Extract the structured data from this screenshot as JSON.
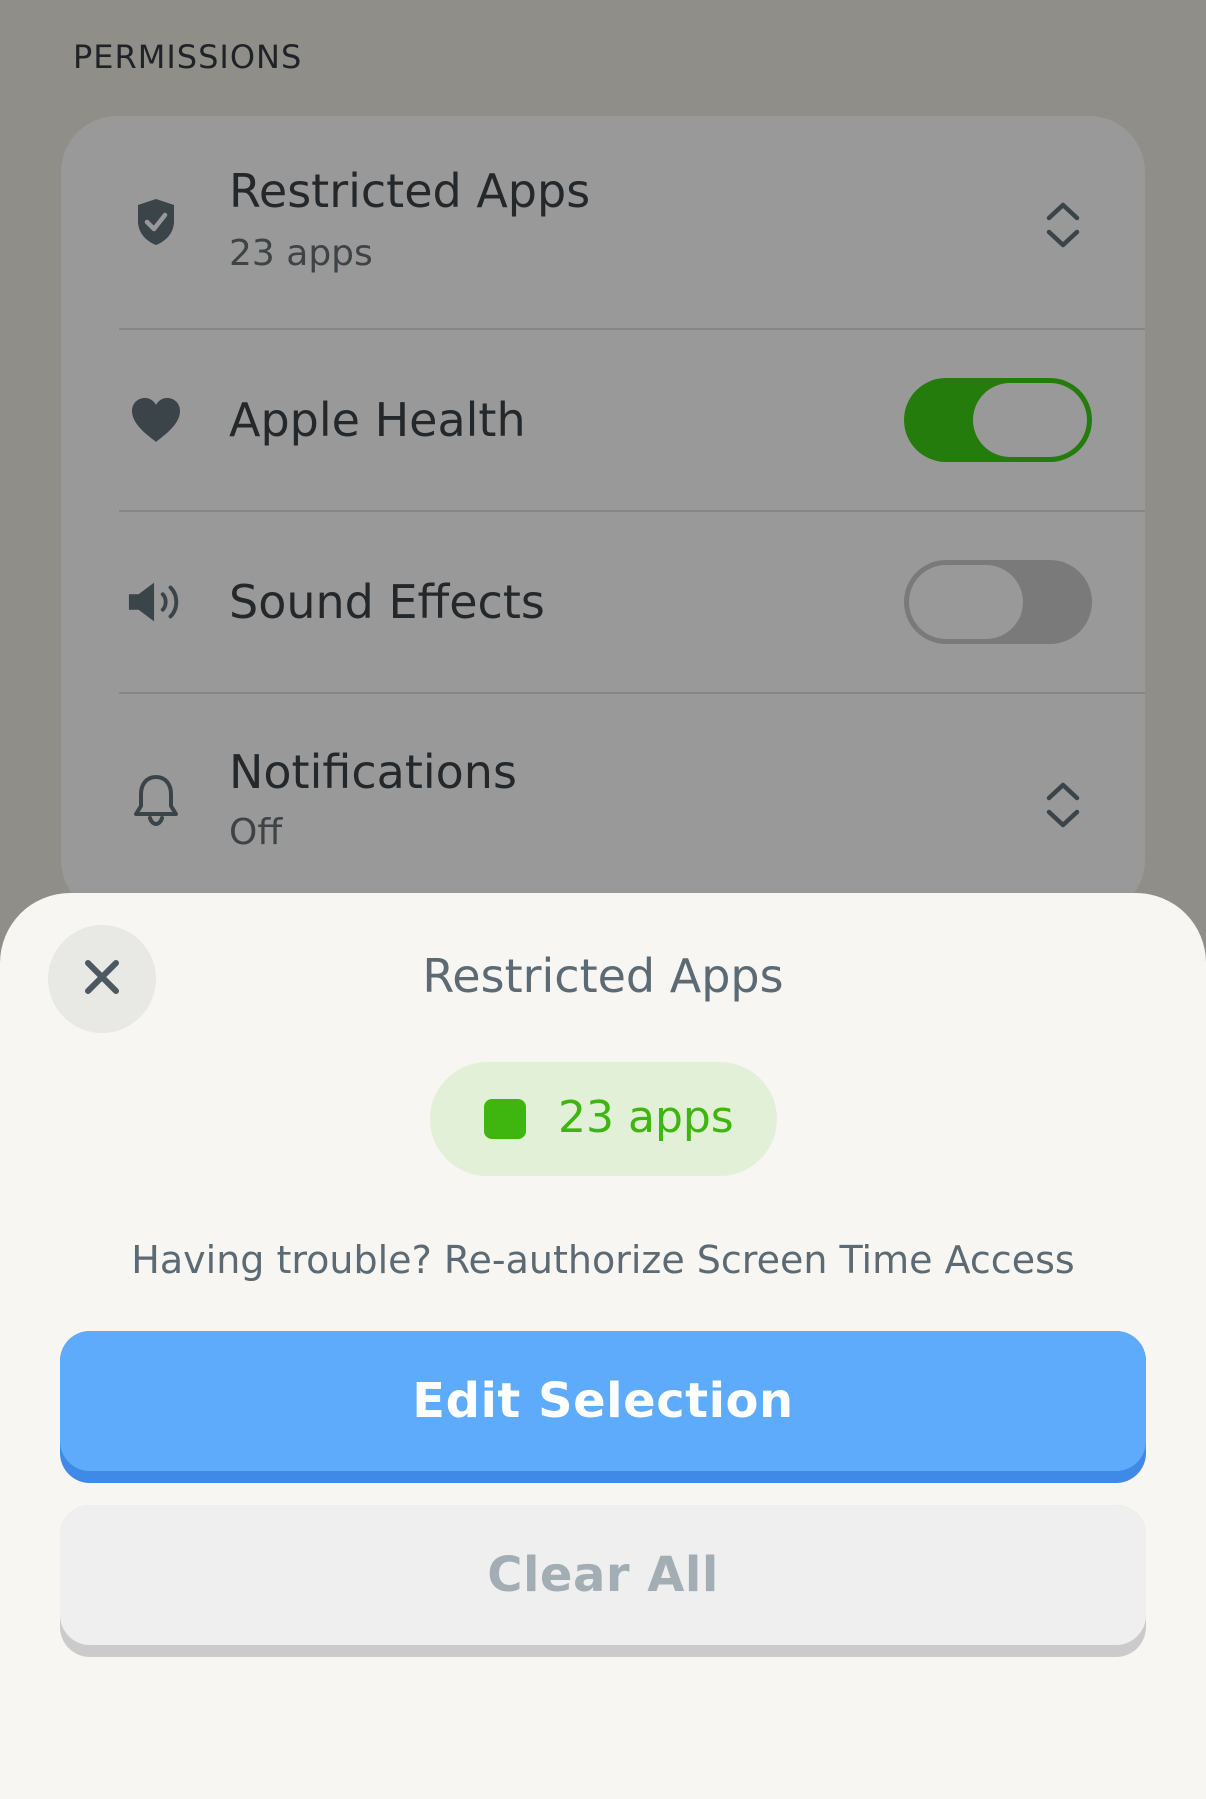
{
  "permissions": {
    "section_title": "PERMISSIONS",
    "rows": [
      {
        "icon": "shield-check-icon",
        "title": "Restricted Apps",
        "subtitle": "23 apps",
        "control": "chevron-up-down-icon"
      },
      {
        "icon": "heart-icon",
        "title": "Apple Health",
        "control": "toggle",
        "toggle_on": true
      },
      {
        "icon": "speaker-icon",
        "title": "Sound Effects",
        "control": "toggle",
        "toggle_on": false
      },
      {
        "icon": "bell-icon",
        "title": "Notifications",
        "subtitle": "Off",
        "control": "chevron-up-down-icon"
      }
    ]
  },
  "sheet": {
    "close_icon": "close-icon",
    "title": "Restricted Apps",
    "app_count_label": "23 apps",
    "trouble_text": "Having trouble? Re-authorize Screen Time Access",
    "edit_button_label": "Edit Selection",
    "clear_button_label": "Clear All"
  },
  "colors": {
    "toggle_on": "#247c0d",
    "accent_green": "#3fb60f",
    "primary_button": "#5eaafb",
    "sheet_background": "#f7f6f2"
  }
}
